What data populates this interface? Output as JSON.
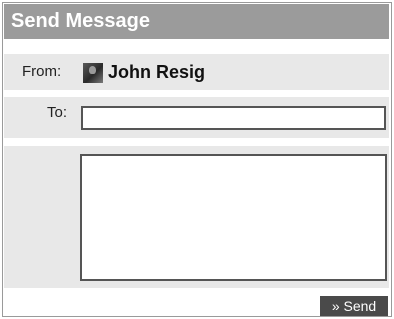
{
  "title": "Send Message",
  "from": {
    "label": "From:",
    "user_name": "John Resig",
    "avatar_icon": "user-avatar-icon"
  },
  "to": {
    "label": "To:",
    "value": "",
    "placeholder": ""
  },
  "message": {
    "value": "",
    "placeholder": ""
  },
  "send": {
    "label": "» Send"
  },
  "colors": {
    "title_bg": "#9b9b9b",
    "row_bg": "#e8e8e8",
    "button_bg": "#4a4a4a",
    "border": "#555555"
  }
}
